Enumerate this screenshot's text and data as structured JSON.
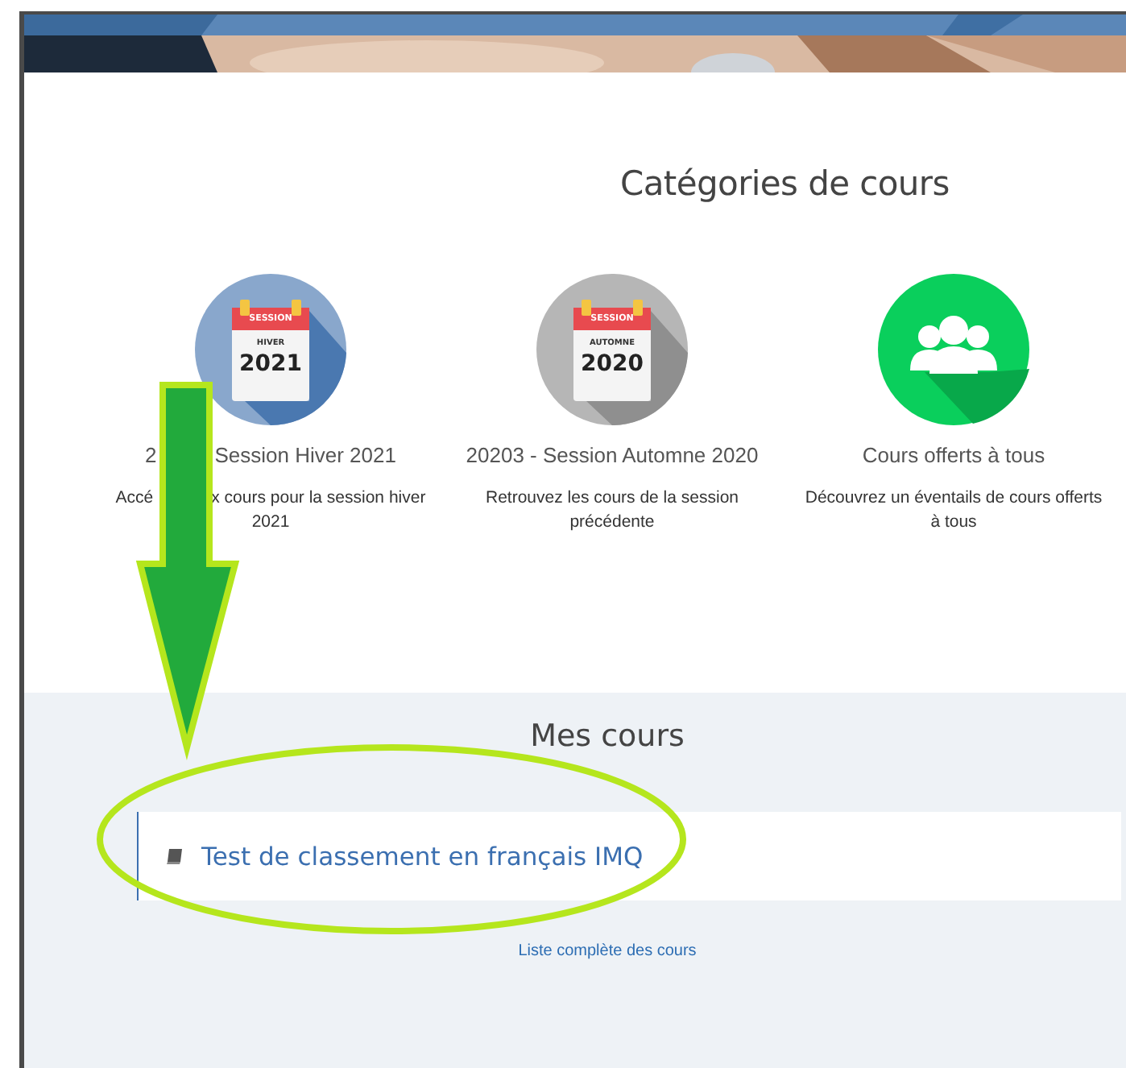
{
  "categories_heading": "Catégories de cours",
  "categories": [
    {
      "icon": {
        "kind": "calendar",
        "color": "#4a78b0",
        "header": "SESSION",
        "season": "HIVER",
        "year": "2021"
      },
      "title_parts": [
        "2",
        "Session Hiver 2021"
      ],
      "description_lines": [
        [
          "Accé",
          "x cours pour la session hiver"
        ],
        [
          "2021"
        ]
      ]
    },
    {
      "icon": {
        "kind": "calendar",
        "color": "#8f8f8f",
        "header": "SESSION",
        "season": "AUTOMNE",
        "year": "2020"
      },
      "title_parts": [
        "20203 - Session Automne 2020"
      ],
      "description_lines": [
        [
          "Retrouvez les cours de la session"
        ],
        [
          "précédente"
        ]
      ]
    },
    {
      "icon": {
        "kind": "group"
      },
      "title_parts": [
        "Cours offerts à tous"
      ],
      "description_lines": [
        [
          "Découvrez un éventails de cours offerts"
        ],
        [
          "à tous"
        ]
      ]
    }
  ],
  "my_courses_heading": "Mes cours",
  "courses": [
    {
      "title": "Test de classement en français IMQ"
    }
  ],
  "all_courses_link": "Liste complète des cours"
}
